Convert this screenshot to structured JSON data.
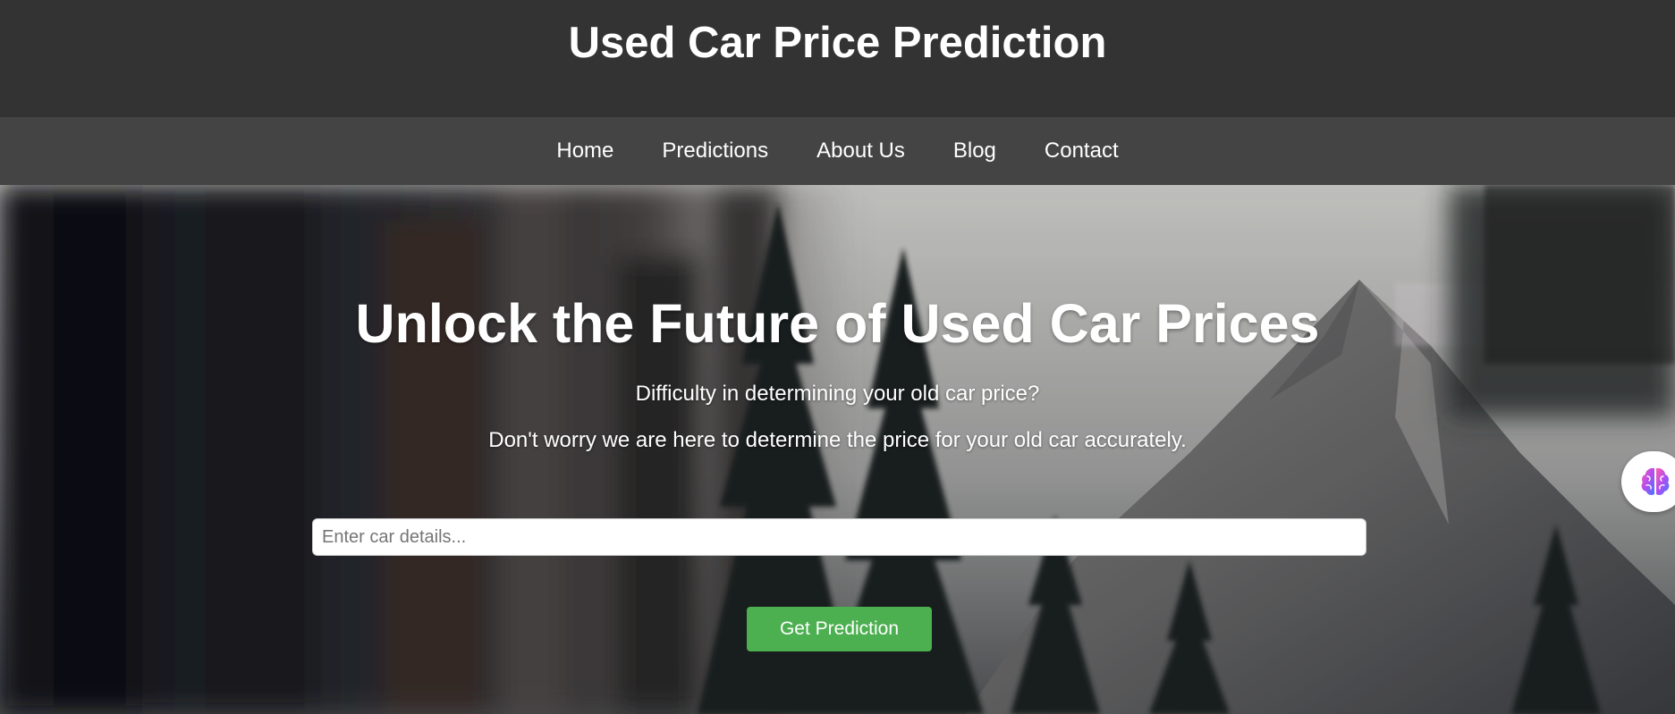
{
  "header": {
    "title": "Used Car Price Prediction"
  },
  "nav": {
    "items": [
      {
        "label": "Home"
      },
      {
        "label": "Predictions"
      },
      {
        "label": "About Us"
      },
      {
        "label": "Blog"
      },
      {
        "label": "Contact"
      }
    ]
  },
  "hero": {
    "heading": "Unlock the Future of Used Car Prices",
    "subtitle_1": "Difficulty in determining your old car price?",
    "subtitle_2": "Don't worry we are here to determine the price for your old car accurately.",
    "search": {
      "placeholder": "Enter car details...",
      "value": ""
    },
    "button_label": "Get Prediction",
    "background_icon": "forest-mountain-image"
  },
  "side_widget": {
    "icon": "brain-icon"
  },
  "colors": {
    "header_bg": "#333333",
    "nav_bg": "#444444",
    "button_bg": "#4caf50",
    "text": "#ffffff"
  }
}
